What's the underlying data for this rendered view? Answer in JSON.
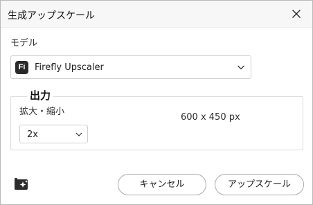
{
  "window": {
    "title": "生成アップスケール"
  },
  "model": {
    "section_label": "モデル",
    "badge": "Fi",
    "selected": "Firefly Upscaler"
  },
  "output": {
    "legend": "出力",
    "scale_label": "拡大・縮小",
    "scale_value": "2x",
    "size_readout": "600 x 450 px"
  },
  "buttons": {
    "cancel": "キャンセル",
    "upscale": "アップスケール"
  },
  "icons": {
    "close": "close-icon",
    "chevron": "chevron-down-icon",
    "feature": "sparkle-image-icon"
  }
}
